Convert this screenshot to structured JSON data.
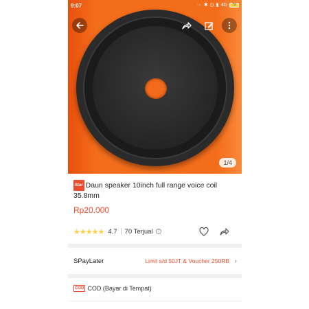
{
  "status_bar": {
    "time": "9:07",
    "network": "4G",
    "battery": "72"
  },
  "gallery": {
    "counter": "1/4",
    "background_color": "#f46d1b"
  },
  "product": {
    "badge": "Star",
    "title": "Daun speaker 10inch full range voice coil 35.8mm",
    "price": "Rp20.000",
    "rating_stars": "★★★★★",
    "rating_value": "4.7",
    "sold": "70 Terjual"
  },
  "paylater": {
    "label": "SPayLater",
    "value": "Limit s/d 50JT & Voucher 250RB"
  },
  "cod": {
    "badge": "COD",
    "label": "COD (Bayar di Tempat)"
  },
  "colors": {
    "accent": "#ee4d2d",
    "star": "#ffce3d"
  },
  "icons": [
    "back-arrow-icon",
    "share-icon",
    "edit-icon",
    "more-icon",
    "help-icon",
    "heart-icon",
    "share-outline-icon",
    "chevron-right-icon"
  ]
}
